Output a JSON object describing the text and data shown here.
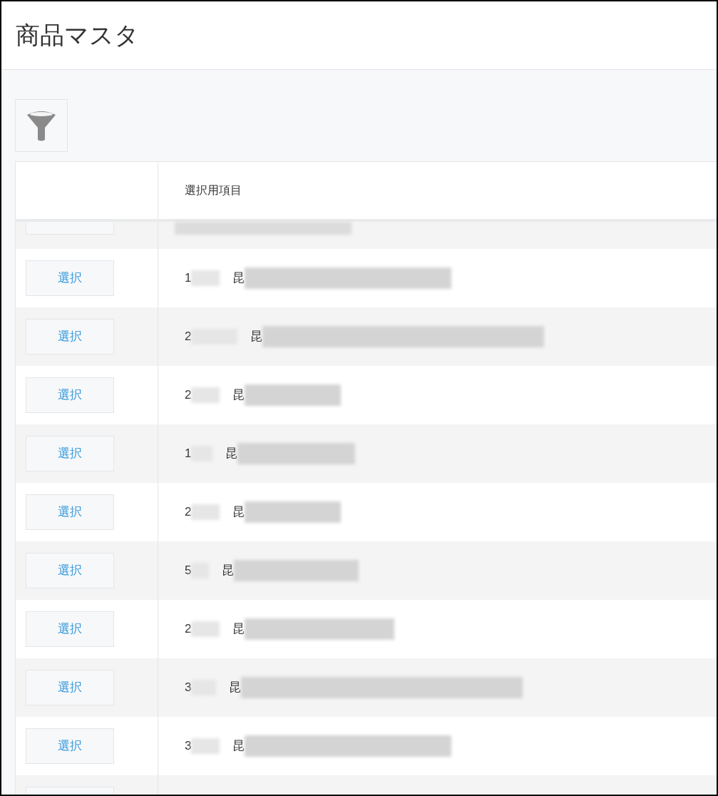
{
  "title": "商品マスタ",
  "table": {
    "column_2": "選択用項目",
    "rows": [
      {
        "button": "選択",
        "code": "1",
        "name": "昆"
      },
      {
        "button": "選択",
        "code": "2",
        "name": "昆"
      },
      {
        "button": "選択",
        "code": "2",
        "name": "昆"
      },
      {
        "button": "選択",
        "code": "1",
        "name": "昆"
      },
      {
        "button": "選択",
        "code": "2",
        "name": "昆"
      },
      {
        "button": "選択",
        "code": "5",
        "name": "昆"
      },
      {
        "button": "選択",
        "code": "2",
        "name": "昆"
      },
      {
        "button": "選択",
        "code": "3",
        "name": "昆"
      },
      {
        "button": "選択",
        "code": "3",
        "name": "昆"
      }
    ]
  }
}
